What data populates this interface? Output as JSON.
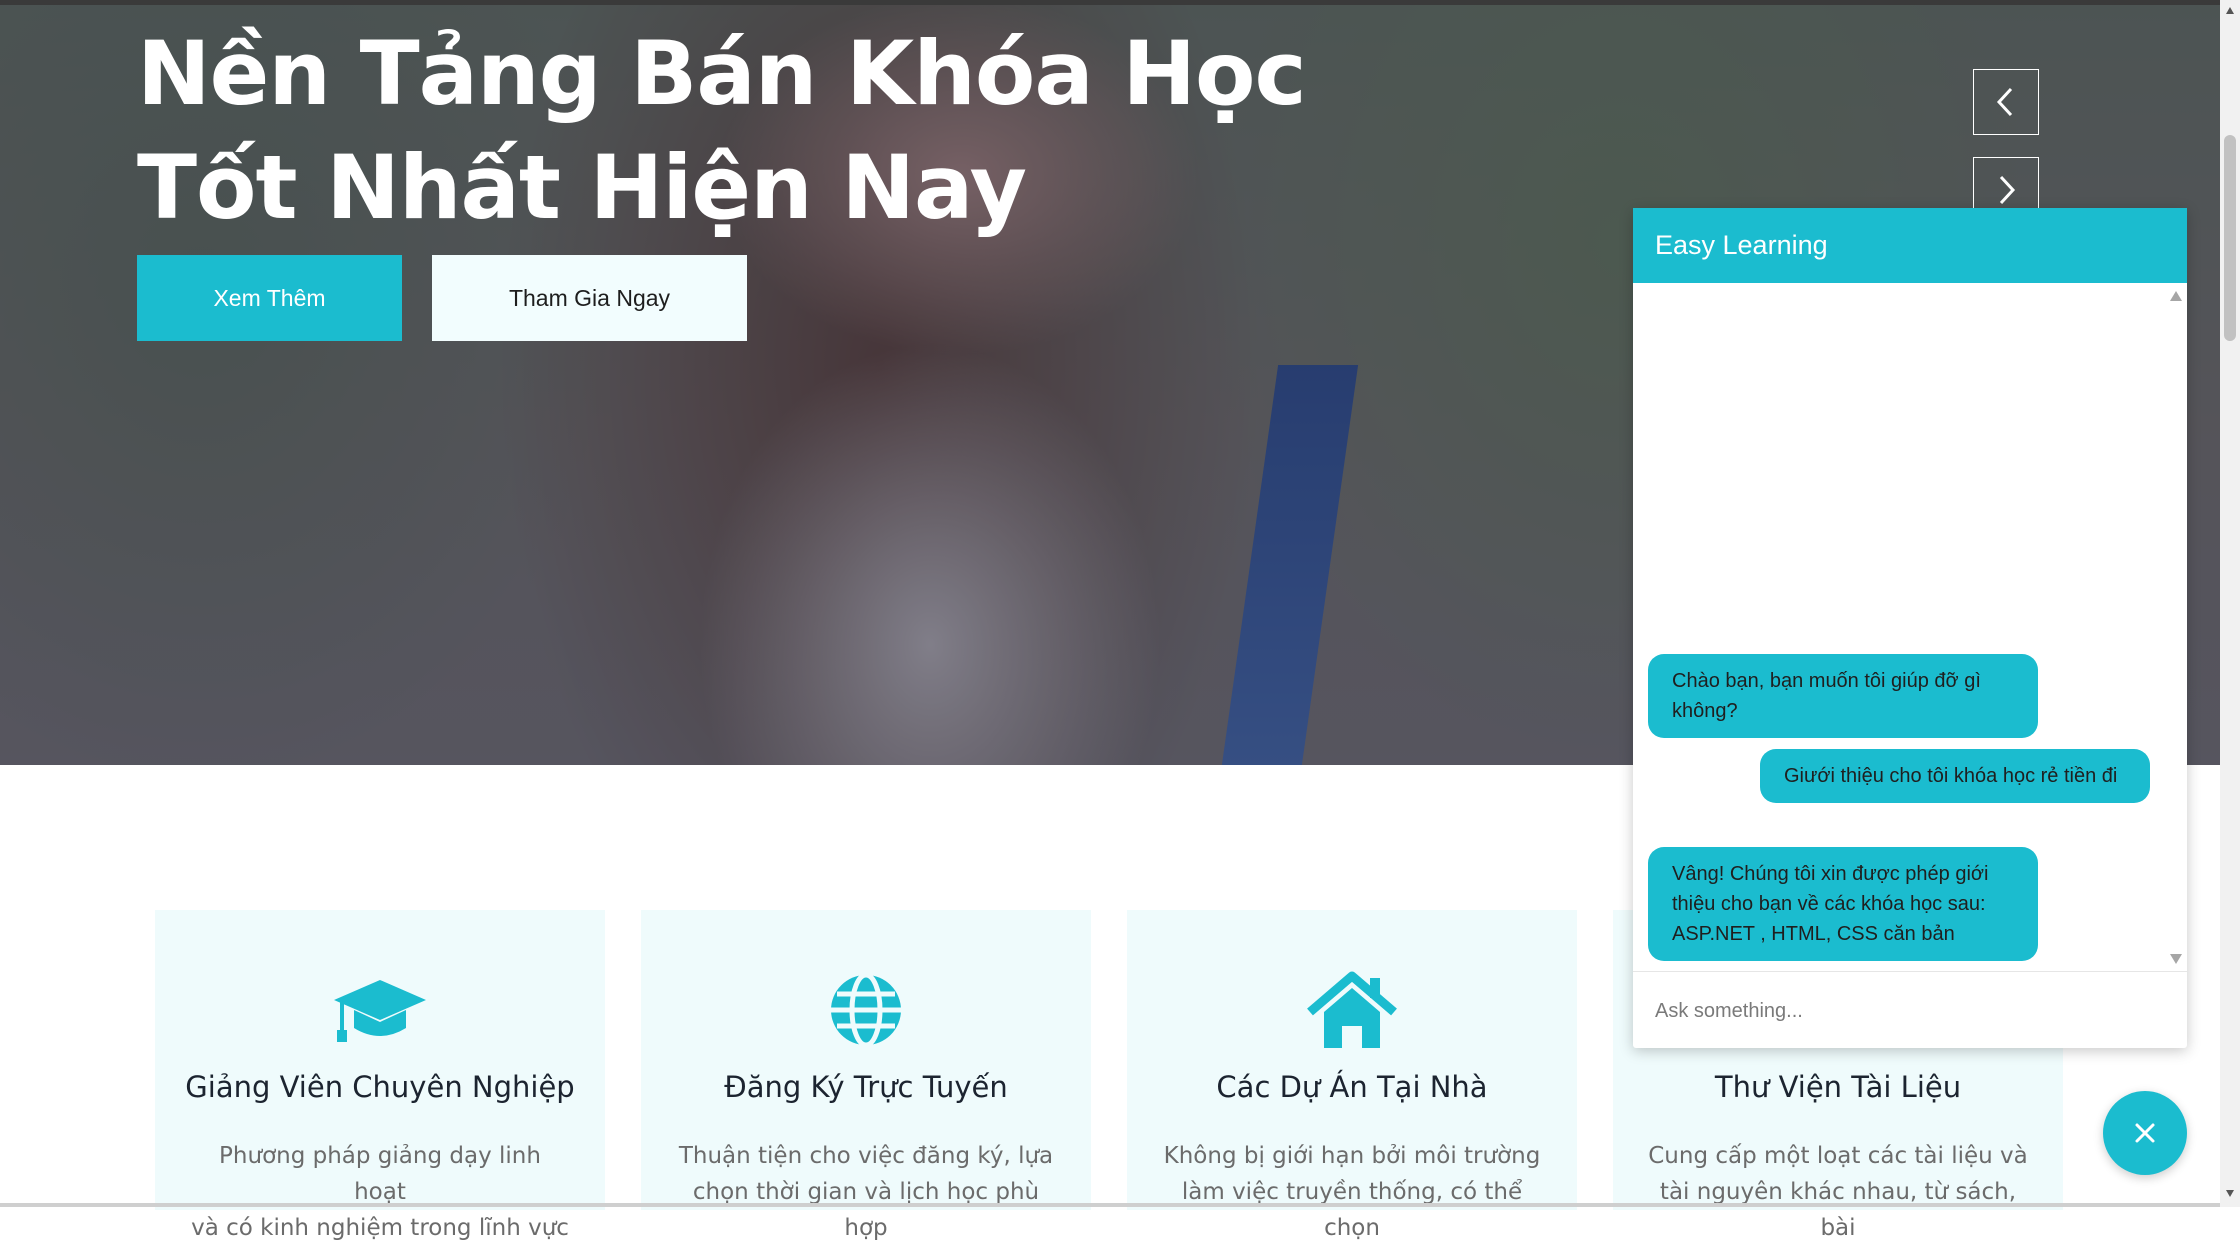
{
  "hero": {
    "title_line1": "Nền Tảng Bán Khóa Học",
    "title_line2": "Tốt Nhất Hiện Nay",
    "primary_button": "Xem Thêm",
    "secondary_button": "Tham Gia Ngay"
  },
  "carousel": {
    "prev_icon": "chevron-left-icon",
    "next_icon": "chevron-right-icon"
  },
  "features": [
    {
      "icon": "graduation-cap-icon",
      "title": "Giảng Viên Chuyên Nghiệp",
      "line1": "Phương pháp giảng dạy linh hoạt",
      "line2": "và có kinh nghiệm trong lĩnh vực"
    },
    {
      "icon": "globe-icon",
      "title": "Đăng Ký Trực Tuyến",
      "line1": "Thuận tiện cho việc đăng ký, lựa",
      "line2": "chọn thời gian và lịch học phù hợp"
    },
    {
      "icon": "home-icon",
      "title": "Các Dự Án Tại Nhà",
      "line1": "Không bị giới hạn bởi môi trường",
      "line2": "làm việc truyền thống, có thể chọn"
    },
    {
      "icon": "book-icon",
      "title": "Thư Viện Tài Liệu",
      "line1": "Cung cấp một loạt các tài liệu và",
      "line2": "tài nguyên khác nhau, từ sách, bài"
    }
  ],
  "chat": {
    "title": "Easy Learning",
    "messages": [
      {
        "from": "bot",
        "text": "Chào bạn, bạn muốn tôi giúp đỡ gì không?"
      },
      {
        "from": "user",
        "text": "Giưới thiệu cho tôi khóa học rẻ tiền đi"
      },
      {
        "from": "bot",
        "text": "Vâng! Chúng tôi xin được phép giới thiệu cho bạn về các khóa học sau: ASP.NET , HTML, CSS căn bản"
      }
    ],
    "input_placeholder": "Ask something...",
    "input_value": ""
  },
  "fab": {
    "icon": "close-icon"
  },
  "colors": {
    "accent": "#1bbccf",
    "card_bg": "#effbfc",
    "light_button": "#f2fdfe"
  }
}
